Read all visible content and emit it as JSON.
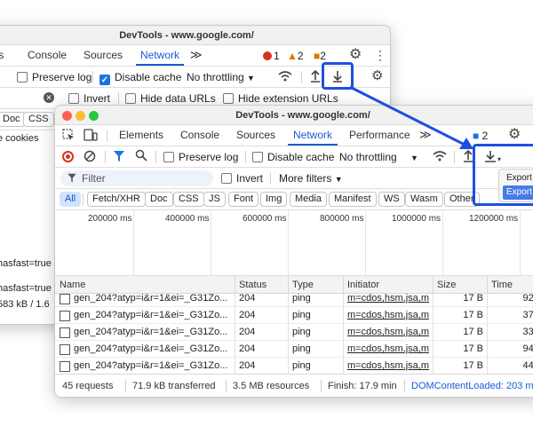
{
  "back_window": {
    "title": "DevTools - www.google.com/",
    "tabs": [
      {
        "label": "ts"
      },
      {
        "label": "Console"
      },
      {
        "label": "Sources"
      },
      {
        "label": "Network"
      }
    ],
    "overflow": "≫",
    "errors": "1",
    "warnings": "2",
    "issues": "2",
    "toolbar": {
      "preserve_log": "Preserve log",
      "disable_cache": "Disable cache",
      "throttling": "No throttling"
    },
    "filter_row": {
      "invert": "Invert",
      "hide_data_urls": "Hide data URLs",
      "hide_extension_urls": "Hide extension URLs"
    },
    "type_pills": [
      {
        "label": "Doc"
      },
      {
        "label": "CSS"
      }
    ],
    "clipped_texts": [
      "e cookies",
      "hasfast=true",
      "hasfast=true",
      "583 kB / 1.6"
    ]
  },
  "front_window": {
    "title": "DevTools - www.google.com/",
    "tabs": [
      {
        "label": "Elements"
      },
      {
        "label": "Console"
      },
      {
        "label": "Sources"
      },
      {
        "label": "Network"
      },
      {
        "label": "Performance"
      }
    ],
    "overflow": "≫",
    "issues": "2",
    "toolbar": {
      "preserve_log": "Preserve log",
      "disable_cache": "Disable cache",
      "throttling": "No throttling"
    },
    "filter": {
      "placeholder": "Filter",
      "invert": "Invert",
      "more_filters": "More filters"
    },
    "type_pills": [
      {
        "label": "All"
      },
      {
        "label": "Fetch/XHR"
      },
      {
        "label": "Doc"
      },
      {
        "label": "CSS"
      },
      {
        "label": "JS"
      },
      {
        "label": "Font"
      },
      {
        "label": "Img"
      },
      {
        "label": "Media"
      },
      {
        "label": "Manifest"
      },
      {
        "label": "WS"
      },
      {
        "label": "Wasm"
      },
      {
        "label": "Other"
      }
    ],
    "timeline_ticks": [
      "200000 ms",
      "400000 ms",
      "600000 ms",
      "800000 ms",
      "1000000 ms",
      "1200000 ms"
    ],
    "table": {
      "headers": [
        "Name",
        "Status",
        "Type",
        "Initiator",
        "Size",
        "Time"
      ],
      "rows": [
        {
          "name": "gen_204?atyp=i&r=1&ei=_G31Zo...",
          "status": "204",
          "type": "ping",
          "initiator": "m=cdos,hsm,jsa,mb",
          "size": "17 B",
          "time": "92 m"
        },
        {
          "name": "gen_204?atyp=i&r=1&ei=_G31Zo...",
          "status": "204",
          "type": "ping",
          "initiator": "m=cdos,hsm,jsa,mb",
          "size": "17 B",
          "time": "37 m"
        },
        {
          "name": "gen_204?atyp=i&r=1&ei=_G31Zo...",
          "status": "204",
          "type": "ping",
          "initiator": "m=cdos,hsm,jsa,mb",
          "size": "17 B",
          "time": "33 m"
        },
        {
          "name": "gen_204?atyp=i&r=1&ei=_G31Zo...",
          "status": "204",
          "type": "ping",
          "initiator": "m=cdos,hsm,jsa,mb",
          "size": "17 B",
          "time": "94 m"
        },
        {
          "name": "gen_204?atyp=i&r=1&ei=_G31Zo...",
          "status": "204",
          "type": "ping",
          "initiator": "m=cdos,hsm,jsa,mb",
          "size": "17 B",
          "time": "44 m"
        }
      ]
    },
    "status": {
      "requests": "45 requests",
      "transferred": "71.9 kB transferred",
      "resources": "3.5 MB resources",
      "finish": "Finish: 17.9 min",
      "dom_content_loaded": "DOMContentLoaded: 203 m"
    },
    "export_menu": [
      {
        "label": "Export"
      },
      {
        "label": "Export"
      }
    ]
  },
  "colors": {
    "highlight": "#1f4fe0",
    "accent": "#1a5ad7",
    "error": "#d93025",
    "warning": "#e37400",
    "issue": "#1a73e8"
  }
}
